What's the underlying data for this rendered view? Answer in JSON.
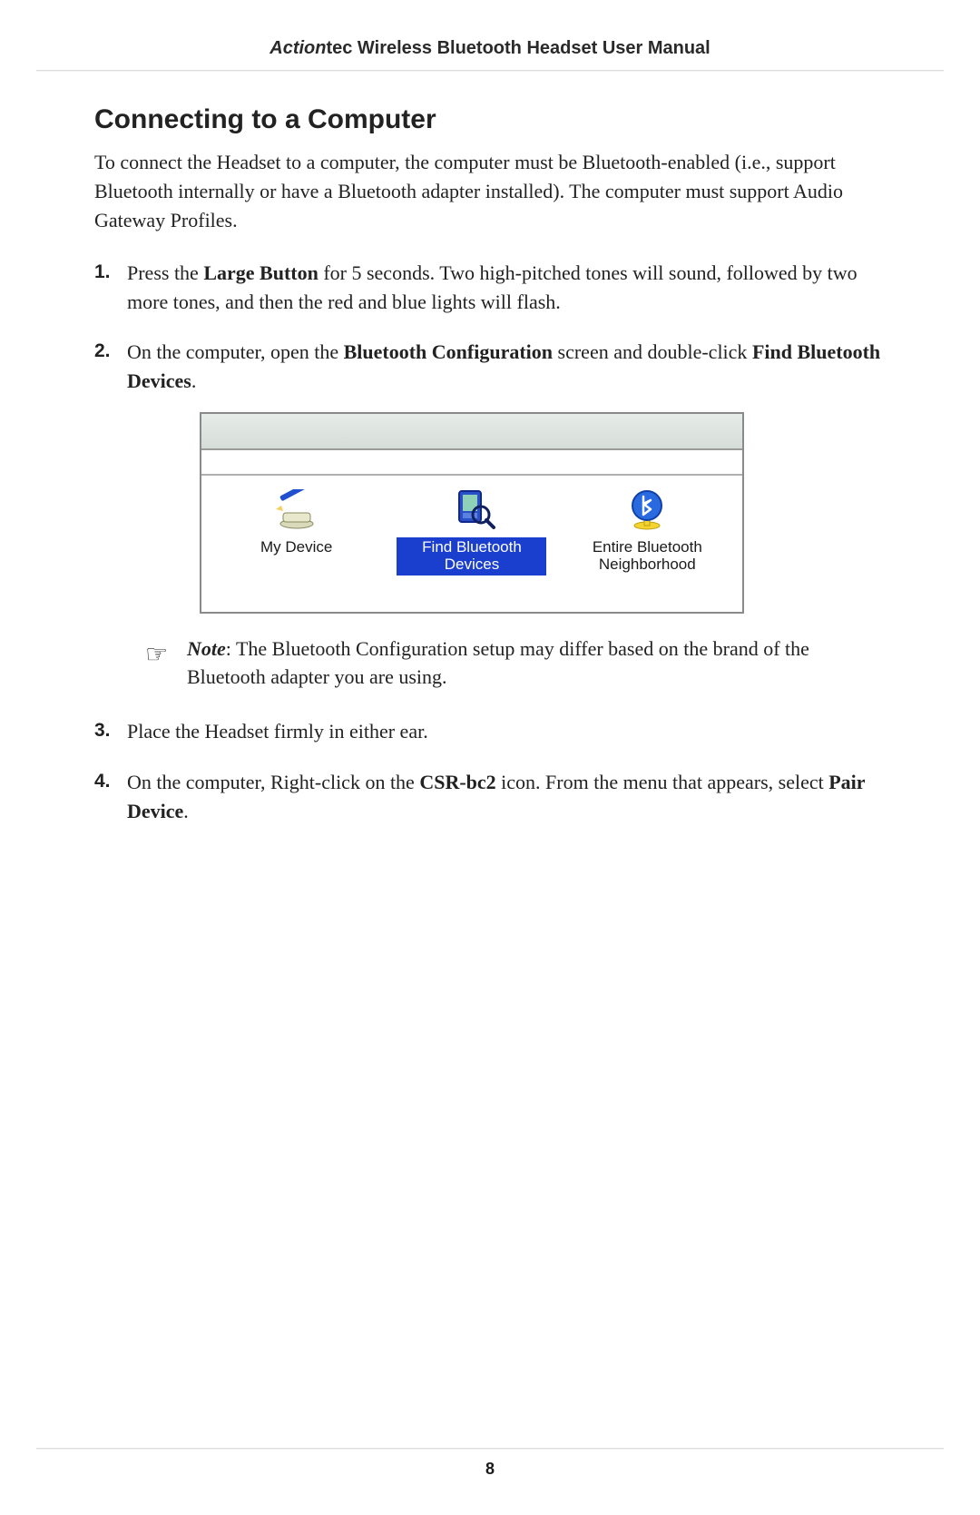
{
  "header": {
    "brand": "Action",
    "brand_suffix": "tec",
    "title_rest": " Wireless Bluetooth Headset User Manual"
  },
  "section_title": "Connecting to a Computer",
  "intro": "To connect the Headset to a computer, the computer must be Bluetooth-enabled (i.e., support Bluetooth internally or have a Bluetooth adapter installed). The computer must support Audio Gateway Profiles.",
  "steps": {
    "s1": {
      "num": "1.",
      "pre": "Press the ",
      "bold1": "Large Button",
      "post": " for 5 seconds. Two high-pitched tones will sound, followed by two more tones, and then the red and blue lights will flash."
    },
    "s2": {
      "num": "2.",
      "pre": "On the computer, open the ",
      "bold1": "Bluetooth Configuration",
      "mid": " screen and double-click ",
      "bold2": "Find Bluetooth Devices",
      "post": "."
    },
    "s3": {
      "num": "3.",
      "text": "Place the Headset firmly in either ear."
    },
    "s4": {
      "num": "4.",
      "pre": "On the computer, Right-click on the ",
      "bold1": "CSR-bc2",
      "mid": " icon. From the menu that appears, select ",
      "bold2": "Pair Device",
      "post": "."
    }
  },
  "bt_window": {
    "items": [
      {
        "label": "My Device",
        "icon": "device-pen",
        "selected": false
      },
      {
        "label": "Find Bluetooth Devices",
        "icon": "pda-magnifier",
        "selected": true
      },
      {
        "label": "Entire Bluetooth Neighborhood",
        "icon": "bluetooth-globe",
        "selected": false
      }
    ]
  },
  "note": {
    "label": "Note",
    "body": ": The Bluetooth Configuration setup may differ based on the brand of the Bluetooth adapter you are using."
  },
  "page_number": "8"
}
